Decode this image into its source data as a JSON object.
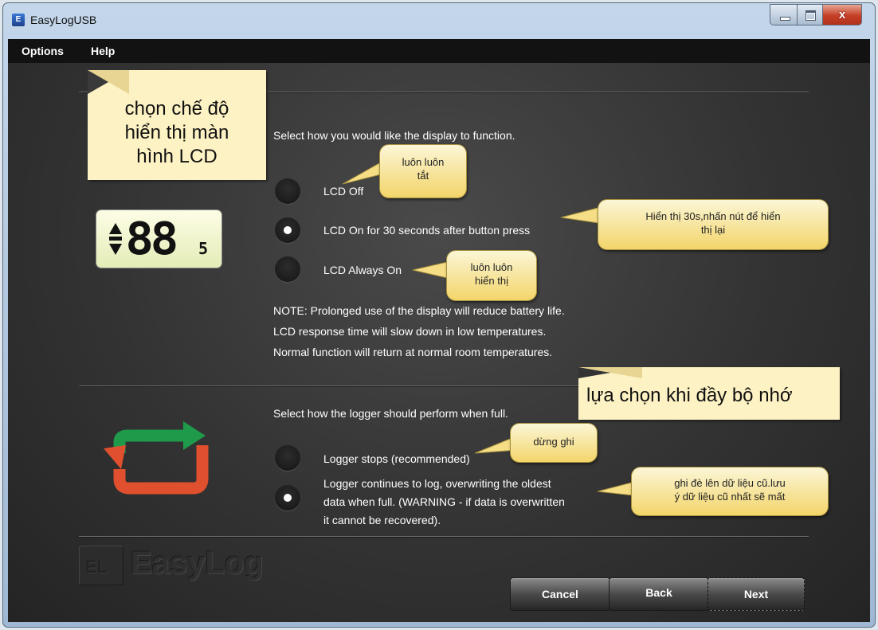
{
  "window": {
    "title": "EasyLogUSB",
    "icon": "easylog-app-icon",
    "close_glyph": "x"
  },
  "menu": {
    "items": [
      "Options",
      "Help"
    ]
  },
  "display_section": {
    "prompt": "Select how you would like the display to function.",
    "options": [
      {
        "label": "LCD Off",
        "selected": false
      },
      {
        "label": "LCD On for 30 seconds after button press",
        "selected": true
      },
      {
        "label": "LCD Always On",
        "selected": false
      }
    ],
    "note_lines": [
      "NOTE: Prolonged use of the display will reduce battery life.",
      "LCD response time will slow down in low temperatures.",
      "Normal function will return at normal room temperatures."
    ],
    "lcd_digits": "88",
    "lcd_small": "5"
  },
  "logger_section": {
    "prompt": "Select how the logger should perform when full.",
    "options": [
      {
        "lines": [
          "Logger stops (recommended)"
        ],
        "selected": false
      },
      {
        "lines": [
          "Logger continues to log, overwriting the oldest",
          "data when full. (WARNING - if data is overwritten",
          "it cannot be recovered)."
        ],
        "selected": true
      }
    ]
  },
  "annotations": {
    "display_note": [
      "chọn chế độ",
      "hiển thị màn",
      "hình LCD"
    ],
    "memory_note": "lựa chọn khi đầy bộ nhớ",
    "bubble_off": [
      "luôn luôn",
      "tắt"
    ],
    "bubble_30s": [
      "Hiển thị 30s,nhấn nút để hiển",
      "thị lại"
    ],
    "bubble_always": [
      "luôn luôn",
      "hiển thị"
    ],
    "bubble_stop": [
      "dừng ghi"
    ],
    "bubble_overwrite": [
      "ghi đè lên dữ liệu cũ.lưu",
      "ý dữ liệu cũ nhất sẽ mất"
    ]
  },
  "logo": {
    "text": "EasyLog",
    "mark": "EL"
  },
  "buttons": {
    "cancel": "Cancel",
    "back": "Back",
    "next": "Next"
  },
  "colors": {
    "arrow_green": "#1f9a4a",
    "arrow_red": "#e0502e",
    "note_bg": "#fdf2c3"
  }
}
